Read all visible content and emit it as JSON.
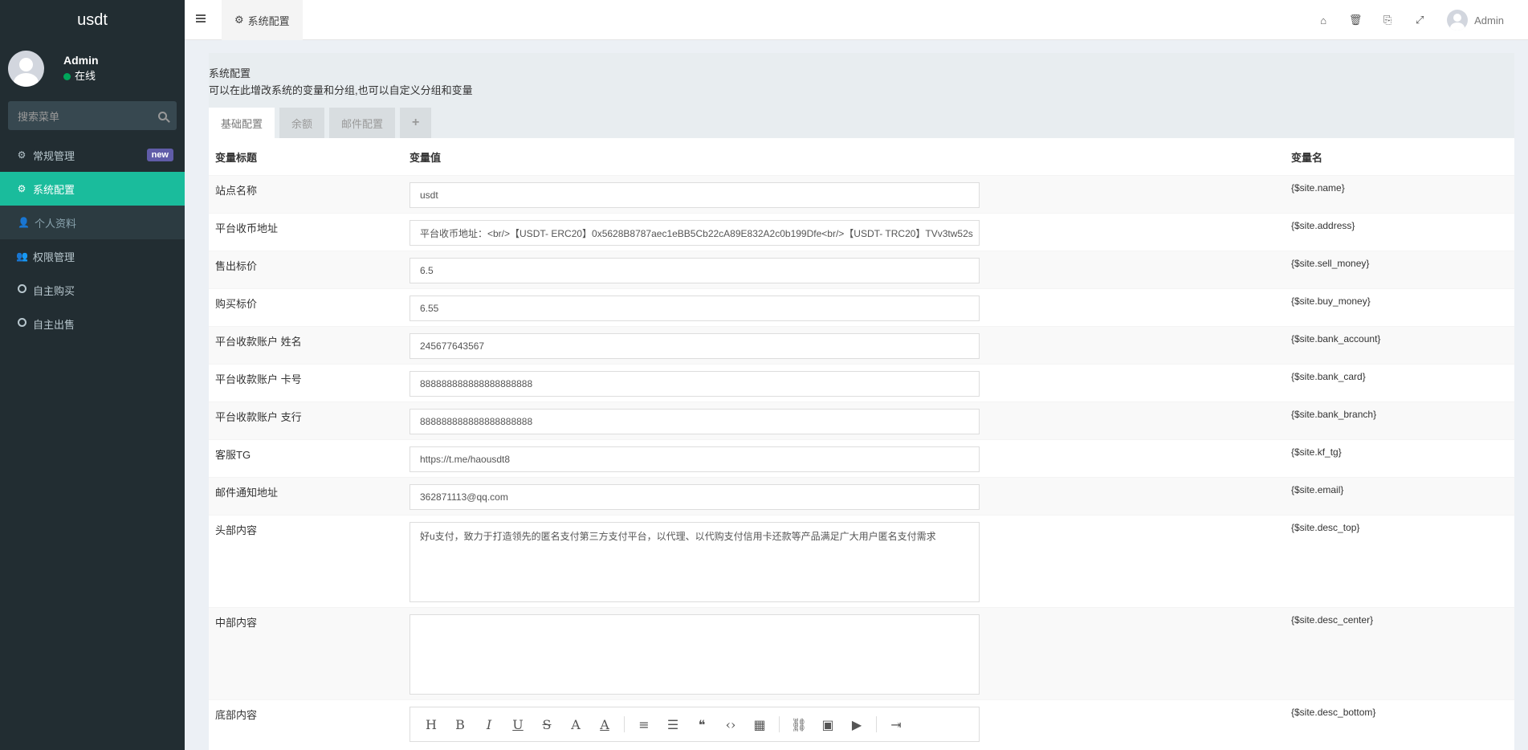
{
  "app": {
    "logo": "usdt"
  },
  "user": {
    "name": "Admin",
    "status": "在线"
  },
  "sidebar": {
    "search_placeholder": "搜索菜单",
    "items": [
      {
        "label": "常规管理",
        "badge": "new"
      },
      {
        "label": "系统配置"
      },
      {
        "label": "个人资料"
      },
      {
        "label": "权限管理"
      },
      {
        "label": "自主购买"
      },
      {
        "label": "自主出售"
      }
    ]
  },
  "topbar": {
    "active_tab": "系统配置",
    "user": "Admin"
  },
  "panel": {
    "title": "系统配置",
    "desc": "可以在此增改系统的变量和分组,也可以自定义分组和变量",
    "tabs": [
      "基础配置",
      "余额",
      "邮件配置",
      "+"
    ]
  },
  "table": {
    "headers": [
      "变量标题",
      "变量值",
      "变量名"
    ],
    "rows": [
      {
        "title": "站点名称",
        "value": "usdt",
        "var": "{$site.name}"
      },
      {
        "title": "平台收币地址",
        "value": "平台收币地址：<br/>【USDT- ERC20】0x5628B8787aec1eBB5Cb22cA89E832A2c0b199Dfe<br/>【USDT- TRC20】TVv3tw52s",
        "var": "{$site.address}"
      },
      {
        "title": "售出标价",
        "value": "6.5",
        "var": "{$site.sell_money}"
      },
      {
        "title": "购买标价",
        "value": "6.55",
        "var": "{$site.buy_money}"
      },
      {
        "title": "平台收款账户 姓名",
        "value": "245677643567",
        "var": "{$site.bank_account}"
      },
      {
        "title": "平台收款账户 卡号",
        "value": "888888888888888888888",
        "var": "{$site.bank_card}"
      },
      {
        "title": "平台收款账户 支行",
        "value": "888888888888888888888",
        "var": "{$site.bank_branch}"
      },
      {
        "title": "客服TG",
        "value": "https://t.me/haousdt8",
        "var": "{$site.kf_tg}"
      },
      {
        "title": "邮件通知地址",
        "value": "362871113@qq.com",
        "var": "{$site.email}"
      },
      {
        "title": "头部内容",
        "value": "好u支付，致力于打造领先的匿名支付第三方支付平台，以代理、以代购支付信用卡还款等产品满足广大用户匿名支付需求",
        "var": "{$site.desc_top}"
      },
      {
        "title": "中部内容",
        "value": "",
        "var": "{$site.desc_center}"
      },
      {
        "title": "底部内容",
        "value": "",
        "var": "{$site.desc_bottom}"
      }
    ]
  },
  "icons": {
    "menu": "hamburger-icon",
    "home": "home-icon",
    "trash": "trash-icon",
    "translate": "translate-icon",
    "fullscreen": "fullscreen-icon"
  }
}
